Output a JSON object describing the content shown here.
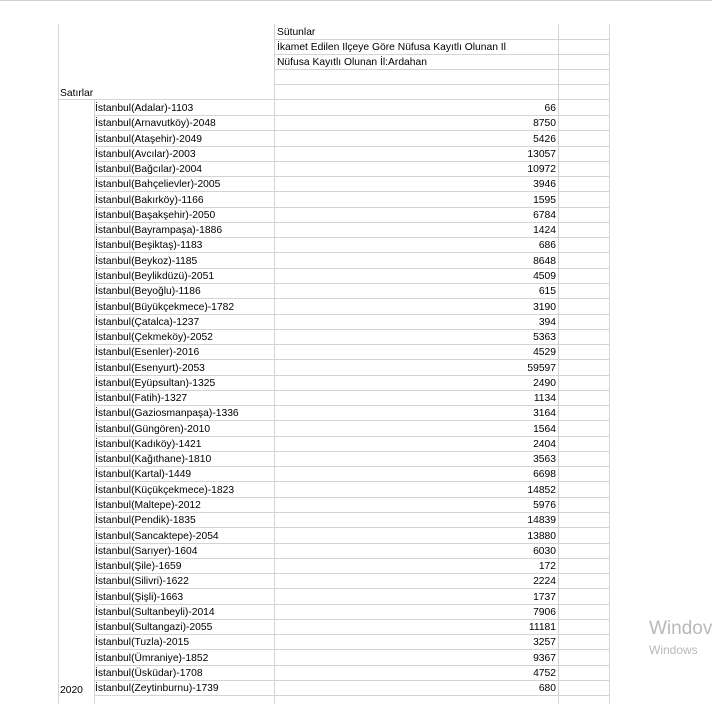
{
  "header": {
    "columns_label": "Sütunlar",
    "col_title_line1": "İkamet Edilen Ilçeye Göre Nüfusa Kayıtlı Olunan Il",
    "col_title_line2": "Nüfusa Kayıtlı Olunan İl:Ardahan",
    "rows_label": "Satırlar"
  },
  "year": "2020",
  "rows": [
    {
      "name": "İstanbul(Adalar)-1103",
      "value": "66"
    },
    {
      "name": "İstanbul(Arnavutköy)-2048",
      "value": "8750"
    },
    {
      "name": "İstanbul(Ataşehir)-2049",
      "value": "5426"
    },
    {
      "name": "İstanbul(Avcılar)-2003",
      "value": "13057"
    },
    {
      "name": "İstanbul(Bağcılar)-2004",
      "value": "10972"
    },
    {
      "name": "İstanbul(Bahçelievler)-2005",
      "value": "3946"
    },
    {
      "name": "İstanbul(Bakırköy)-1166",
      "value": "1595"
    },
    {
      "name": "İstanbul(Başakşehir)-2050",
      "value": "6784"
    },
    {
      "name": "İstanbul(Bayrampaşa)-1886",
      "value": "1424"
    },
    {
      "name": "İstanbul(Beşiktaş)-1183",
      "value": "686"
    },
    {
      "name": "İstanbul(Beykoz)-1185",
      "value": "8648"
    },
    {
      "name": "İstanbul(Beylikdüzü)-2051",
      "value": "4509"
    },
    {
      "name": "İstanbul(Beyoğlu)-1186",
      "value": "615"
    },
    {
      "name": "İstanbul(Büyükçekmece)-1782",
      "value": "3190"
    },
    {
      "name": "İstanbul(Çatalca)-1237",
      "value": "394"
    },
    {
      "name": "İstanbul(Çekmeköy)-2052",
      "value": "5363"
    },
    {
      "name": "İstanbul(Esenler)-2016",
      "value": "4529"
    },
    {
      "name": "İstanbul(Esenyurt)-2053",
      "value": "59597"
    },
    {
      "name": "İstanbul(Eyüpsultan)-1325",
      "value": "2490"
    },
    {
      "name": "İstanbul(Fatih)-1327",
      "value": "1134"
    },
    {
      "name": "İstanbul(Gaziosmanpaşa)-1336",
      "value": "3164"
    },
    {
      "name": "İstanbul(Güngören)-2010",
      "value": "1564"
    },
    {
      "name": "İstanbul(Kadıköy)-1421",
      "value": "2404"
    },
    {
      "name": "İstanbul(Kağıthane)-1810",
      "value": "3563"
    },
    {
      "name": "İstanbul(Kartal)-1449",
      "value": "6698"
    },
    {
      "name": "İstanbul(Küçükçekmece)-1823",
      "value": "14852"
    },
    {
      "name": "İstanbul(Maltepe)-2012",
      "value": "5976"
    },
    {
      "name": "İstanbul(Pendik)-1835",
      "value": "14839"
    },
    {
      "name": "İstanbul(Sancaktepe)-2054",
      "value": "13880"
    },
    {
      "name": "İstanbul(Sarıyer)-1604",
      "value": "6030"
    },
    {
      "name": "İstanbul(Şile)-1659",
      "value": "172"
    },
    {
      "name": "İstanbul(Silivri)-1622",
      "value": "2224"
    },
    {
      "name": "İstanbul(Şişli)-1663",
      "value": "1737"
    },
    {
      "name": "İstanbul(Sultanbeyli)-2014",
      "value": "7906"
    },
    {
      "name": "İstanbul(Sultangazi)-2055",
      "value": "11181"
    },
    {
      "name": "İstanbul(Tuzla)-2015",
      "value": "3257"
    },
    {
      "name": "İstanbul(Ümraniye)-1852",
      "value": "9367"
    },
    {
      "name": "İstanbul(Üsküdar)-1708",
      "value": "4752"
    },
    {
      "name": "İstanbul(Zeytinburnu)-1739",
      "value": "680"
    }
  ],
  "watermark": {
    "line1": "Windov",
    "line2": "Windows"
  }
}
